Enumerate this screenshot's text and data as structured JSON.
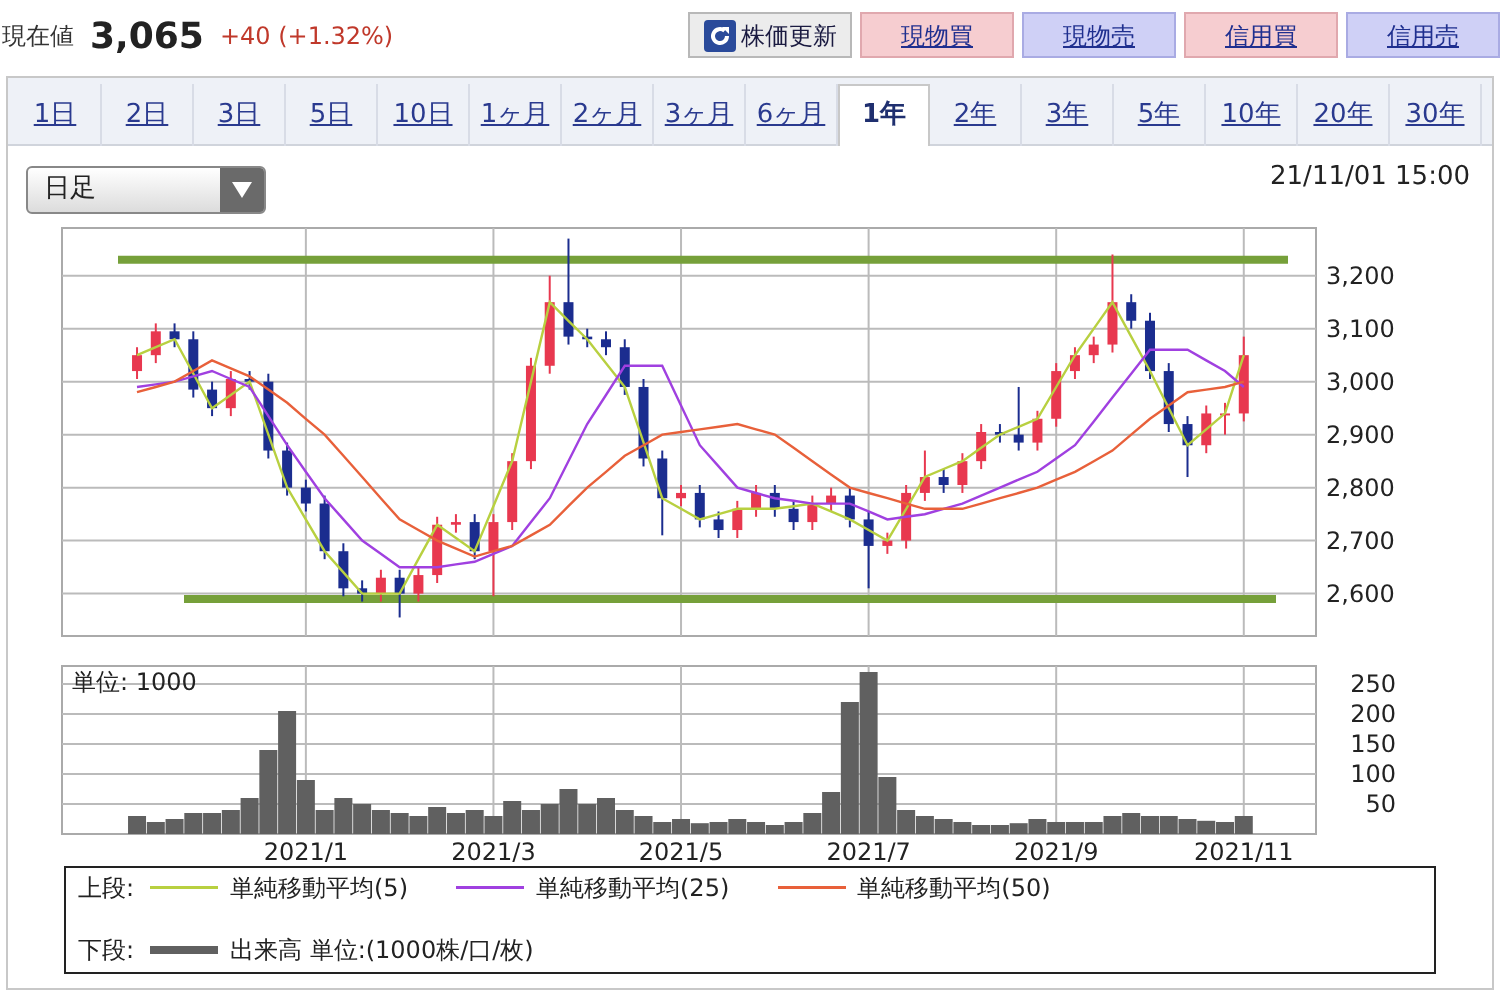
{
  "quote": {
    "label": "現在値",
    "price": "3,065",
    "change": "+40 (+1.32%)"
  },
  "buttons": [
    {
      "label": "株価更新",
      "kind": "refresh"
    },
    {
      "label": "現物買",
      "kind": "buy"
    },
    {
      "label": "現物売",
      "kind": "sell"
    },
    {
      "label": "信用買",
      "kind": "buy"
    },
    {
      "label": "信用売",
      "kind": "sell"
    }
  ],
  "tabs": [
    {
      "label": "1日",
      "selected": false
    },
    {
      "label": "2日",
      "selected": false
    },
    {
      "label": "3日",
      "selected": false
    },
    {
      "label": "5日",
      "selected": false
    },
    {
      "label": "10日",
      "selected": false
    },
    {
      "label": "1ヶ月",
      "selected": false
    },
    {
      "label": "2ヶ月",
      "selected": false
    },
    {
      "label": "3ヶ月",
      "selected": false
    },
    {
      "label": "6ヶ月",
      "selected": false
    },
    {
      "label": "1年",
      "selected": true
    },
    {
      "label": "2年",
      "selected": false
    },
    {
      "label": "3年",
      "selected": false
    },
    {
      "label": "5年",
      "selected": false
    },
    {
      "label": "10年",
      "selected": false
    },
    {
      "label": "20年",
      "selected": false
    },
    {
      "label": "30年",
      "selected": false
    }
  ],
  "period_select": {
    "value": "日足"
  },
  "timestamp": "21/11/01 15:00",
  "price_chart": {
    "chart_data": {
      "type": "candlestick",
      "grid": true,
      "ylim": [
        2520,
        3290
      ],
      "ref_lines": [
        {
          "axis": "y",
          "value": 3230,
          "color": "#76a03a"
        },
        {
          "axis": "y",
          "value": 2590,
          "color": "#76a03a"
        }
      ],
      "yticks": [
        {
          "value": 2600,
          "label": "2,600"
        },
        {
          "value": 2700,
          "label": "2,700"
        },
        {
          "value": 2800,
          "label": "2,800"
        },
        {
          "value": 2900,
          "label": "2,900"
        },
        {
          "value": 3000,
          "label": "3,000"
        },
        {
          "value": 3100,
          "label": "3,100"
        },
        {
          "value": 3200,
          "label": "3,200"
        }
      ],
      "categories": [
        null,
        null,
        null,
        null,
        null,
        null,
        null,
        null,
        null,
        null,
        null,
        null,
        null,
        null,
        null,
        null,
        null,
        null,
        null,
        null,
        null,
        null,
        null,
        null,
        null,
        null,
        null,
        null,
        null,
        null,
        null,
        null,
        null,
        null,
        null,
        null,
        null,
        null,
        null,
        null,
        null,
        null,
        null,
        null,
        null,
        null,
        null,
        null,
        null,
        null,
        null,
        null,
        null,
        null,
        null,
        null,
        null,
        null,
        null,
        null
      ],
      "ohlc": [
        [
          3020,
          3065,
          3005,
          3050
        ],
        [
          3050,
          3110,
          3035,
          3095
        ],
        [
          3095,
          3110,
          3065,
          3080
        ],
        [
          3080,
          3095,
          2970,
          2985
        ],
        [
          2985,
          3000,
          2935,
          2950
        ],
        [
          2950,
          3020,
          2935,
          3005
        ],
        [
          3005,
          3020,
          2985,
          3000
        ],
        [
          3000,
          3015,
          2855,
          2870
        ],
        [
          2870,
          2885,
          2785,
          2800
        ],
        [
          2800,
          2815,
          2755,
          2770
        ],
        [
          2770,
          2785,
          2665,
          2680
        ],
        [
          2680,
          2695,
          2595,
          2610
        ],
        [
          2610,
          2625,
          2585,
          2600
        ],
        [
          2600,
          2645,
          2585,
          2630
        ],
        [
          2630,
          2645,
          2555,
          2600
        ],
        [
          2600,
          2650,
          2585,
          2635
        ],
        [
          2635,
          2745,
          2620,
          2730
        ],
        [
          2730,
          2750,
          2715,
          2735
        ],
        [
          2735,
          2750,
          2665,
          2680
        ],
        [
          2680,
          2750,
          2595,
          2735
        ],
        [
          2735,
          2865,
          2720,
          2850
        ],
        [
          2850,
          3045,
          2835,
          3030
        ],
        [
          3030,
          3200,
          3015,
          3150
        ],
        [
          3150,
          3270,
          3070,
          3085
        ],
        [
          3085,
          3100,
          3065,
          3080
        ],
        [
          3080,
          3095,
          3050,
          3065
        ],
        [
          3065,
          3080,
          2975,
          2990
        ],
        [
          2990,
          3005,
          2840,
          2855
        ],
        [
          2855,
          2870,
          2710,
          2780
        ],
        [
          2780,
          2805,
          2765,
          2790
        ],
        [
          2790,
          2805,
          2725,
          2740
        ],
        [
          2740,
          2755,
          2705,
          2720
        ],
        [
          2720,
          2775,
          2705,
          2760
        ],
        [
          2760,
          2805,
          2745,
          2790
        ],
        [
          2790,
          2805,
          2745,
          2760
        ],
        [
          2760,
          2775,
          2720,
          2735
        ],
        [
          2735,
          2785,
          2720,
          2770
        ],
        [
          2770,
          2800,
          2755,
          2785
        ],
        [
          2785,
          2800,
          2725,
          2740
        ],
        [
          2740,
          2755,
          2610,
          2690
        ],
        [
          2690,
          2715,
          2675,
          2700
        ],
        [
          2700,
          2805,
          2685,
          2790
        ],
        [
          2790,
          2870,
          2775,
          2820
        ],
        [
          2820,
          2835,
          2790,
          2805
        ],
        [
          2805,
          2865,
          2790,
          2850
        ],
        [
          2850,
          2920,
          2835,
          2905
        ],
        [
          2905,
          2920,
          2885,
          2900
        ],
        [
          2900,
          2990,
          2870,
          2885
        ],
        [
          2885,
          2945,
          2870,
          2930
        ],
        [
          2930,
          3035,
          2915,
          3020
        ],
        [
          3020,
          3065,
          3005,
          3050
        ],
        [
          3050,
          3085,
          3035,
          3070
        ],
        [
          3070,
          3240,
          3055,
          3150
        ],
        [
          3150,
          3165,
          3100,
          3115
        ],
        [
          3115,
          3130,
          3005,
          3020
        ],
        [
          3020,
          3035,
          2905,
          2920
        ],
        [
          2920,
          2935,
          2820,
          2880
        ],
        [
          2880,
          2955,
          2865,
          2940
        ],
        [
          2940,
          2960,
          2900,
          2940
        ],
        [
          2940,
          3085,
          2925,
          3050
        ]
      ],
      "series": [
        {
          "name": "単純移動平均(5)",
          "type": "line",
          "color": "#b8d040",
          "values": [
            3050,
            3065,
            3080,
            3015,
            2950,
            2975,
            3000,
            2900,
            2800,
            2740,
            2680,
            2640,
            2600,
            2600,
            2600,
            2665,
            2730,
            2705,
            2680,
            2765,
            2850,
            3000,
            3150,
            3115,
            3080,
            3035,
            2990,
            2885,
            2780,
            2760,
            2740,
            2750,
            2760,
            2760,
            2760,
            2765,
            2770,
            2755,
            2740,
            2720,
            2700,
            2760,
            2820,
            2835,
            2850,
            2875,
            2900,
            2915,
            2930,
            2990,
            3050,
            3100,
            3150,
            3085,
            3020,
            2950,
            2880,
            2910,
            2940,
            3050
          ]
        },
        {
          "name": "単純移動平均(25)",
          "type": "line",
          "color": "#a040e0",
          "values": [
            2990,
            2995,
            3000,
            3010,
            3020,
            3005,
            2990,
            2935,
            2880,
            2830,
            2780,
            2740,
            2700,
            2675,
            2650,
            2650,
            2650,
            2655,
            2660,
            2675,
            2690,
            2735,
            2780,
            2850,
            2920,
            2975,
            3030,
            3030,
            3030,
            2955,
            2880,
            2840,
            2800,
            2790,
            2780,
            2775,
            2770,
            2770,
            2770,
            2755,
            2740,
            2745,
            2750,
            2760,
            2770,
            2785,
            2800,
            2815,
            2830,
            2855,
            2880,
            2925,
            2970,
            3015,
            3060,
            3060,
            3060,
            3040,
            3020,
            2990
          ]
        },
        {
          "name": "単純移動平均(50)",
          "type": "line",
          "color": "#e8603a",
          "values": [
            2980,
            2990,
            3000,
            3020,
            3040,
            3025,
            3010,
            2985,
            2960,
            2930,
            2900,
            2860,
            2820,
            2780,
            2740,
            2720,
            2700,
            2685,
            2670,
            2680,
            2690,
            2710,
            2730,
            2765,
            2800,
            2830,
            2860,
            2880,
            2900,
            2905,
            2910,
            2915,
            2920,
            2910,
            2900,
            2875,
            2850,
            2825,
            2800,
            2790,
            2780,
            2770,
            2760,
            2760,
            2760,
            2770,
            2780,
            2790,
            2800,
            2815,
            2830,
            2850,
            2870,
            2900,
            2930,
            2955,
            2980,
            2985,
            2990,
            3000
          ]
        }
      ]
    }
  },
  "volume_chart": {
    "unit_label": "単位: 1000",
    "chart_data": {
      "type": "bar",
      "grid": true,
      "ylim": [
        0,
        280
      ],
      "yticks": [
        50,
        100,
        150,
        200,
        250
      ],
      "categories": [
        null,
        null,
        null,
        null,
        null,
        null,
        null,
        null,
        null,
        "2021/1",
        null,
        null,
        null,
        null,
        null,
        null,
        null,
        null,
        null,
        "2021/3",
        null,
        null,
        null,
        null,
        null,
        null,
        null,
        null,
        null,
        "2021/5",
        null,
        null,
        null,
        null,
        null,
        null,
        null,
        null,
        null,
        "2021/7",
        null,
        null,
        null,
        null,
        null,
        null,
        null,
        null,
        null,
        "2021/9",
        null,
        null,
        null,
        null,
        null,
        null,
        null,
        null,
        null,
        "2021/11"
      ],
      "series": [
        {
          "name": "出来高 単位:(1000株/口/枚)",
          "color": "#606060",
          "values": [
            30,
            20,
            25,
            35,
            35,
            40,
            60,
            140,
            205,
            90,
            40,
            60,
            50,
            40,
            35,
            30,
            45,
            35,
            40,
            30,
            55,
            40,
            50,
            75,
            50,
            60,
            40,
            30,
            20,
            25,
            18,
            20,
            25,
            20,
            15,
            20,
            35,
            70,
            220,
            270,
            95,
            40,
            30,
            25,
            20,
            15,
            15,
            18,
            25,
            20,
            20,
            20,
            30,
            35,
            30,
            30,
            25,
            22,
            20,
            30
          ]
        }
      ]
    }
  },
  "legend": {
    "upper": {
      "label": "上段:"
    },
    "lower": {
      "label": "下段:"
    }
  }
}
